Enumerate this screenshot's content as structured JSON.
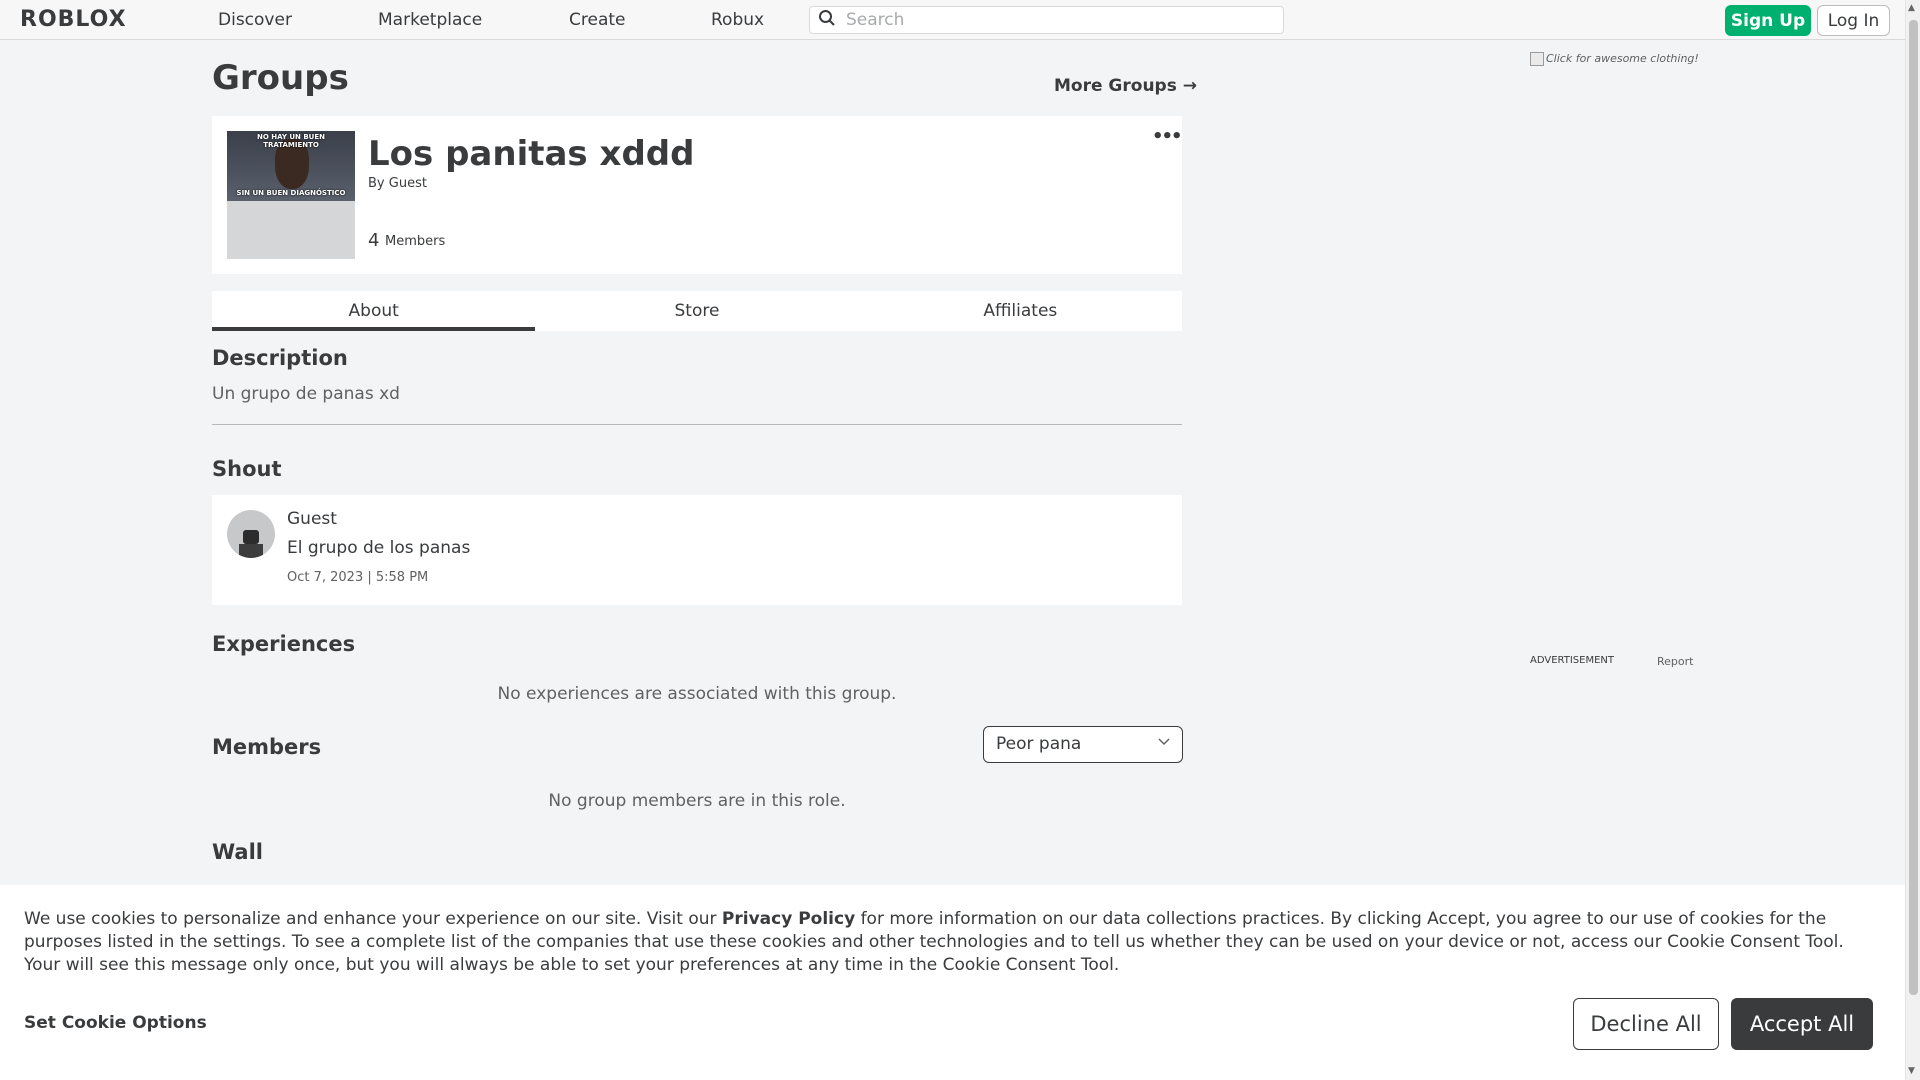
{
  "nav": {
    "logo": "ROBLOX",
    "links": [
      "Discover",
      "Marketplace",
      "Create",
      "Robux"
    ],
    "search_placeholder": "Search",
    "signup": "Sign Up",
    "login": "Log In"
  },
  "page": {
    "title": "Groups",
    "more_groups": "More Groups →"
  },
  "group": {
    "name": "Los panitas xddd",
    "by_label": "By",
    "owner": "Guest",
    "member_count": "4",
    "members_label": "Members",
    "thumb_top_text": "NO HAY UN BUEN TRATAMIENTO",
    "thumb_bottom_text": "SIN UN BUEN DIAGNÓSTICO",
    "menu": "•••"
  },
  "tabs": [
    "About",
    "Store",
    "Affiliates"
  ],
  "description": {
    "heading": "Description",
    "text": "Un grupo de panas xd"
  },
  "shout": {
    "heading": "Shout",
    "author": "Guest",
    "message": "El grupo de los panas",
    "date": "Oct 7, 2023 | 5:58 PM"
  },
  "experiences": {
    "heading": "Experiences",
    "empty": "No experiences are associated with this group."
  },
  "members": {
    "heading": "Members",
    "role_selected": "Peor pana",
    "empty": "No group members are in this role."
  },
  "wall": {
    "heading": "Wall"
  },
  "ad": {
    "image_alt": "Click for awesome clothing!",
    "label": "ADVERTISEMENT",
    "report": "Report"
  },
  "cookie": {
    "text_before": "We use cookies to personalize and enhance your experience on our site. Visit our ",
    "privacy_link": "Privacy Policy",
    "text_after": " for more information on our data collections practices. By clicking Accept, you agree to our use of cookies for the purposes listed in the settings. To see a complete list of the companies that use these cookies and other technologies and to tell us whether they can be used on your device or not, access our Cookie Consent Tool. Your will see this message only once, but you will always be able to set your preferences at any time in the Cookie Consent Tool.",
    "set_options": "Set Cookie Options",
    "decline": "Decline All",
    "accept": "Accept All"
  }
}
